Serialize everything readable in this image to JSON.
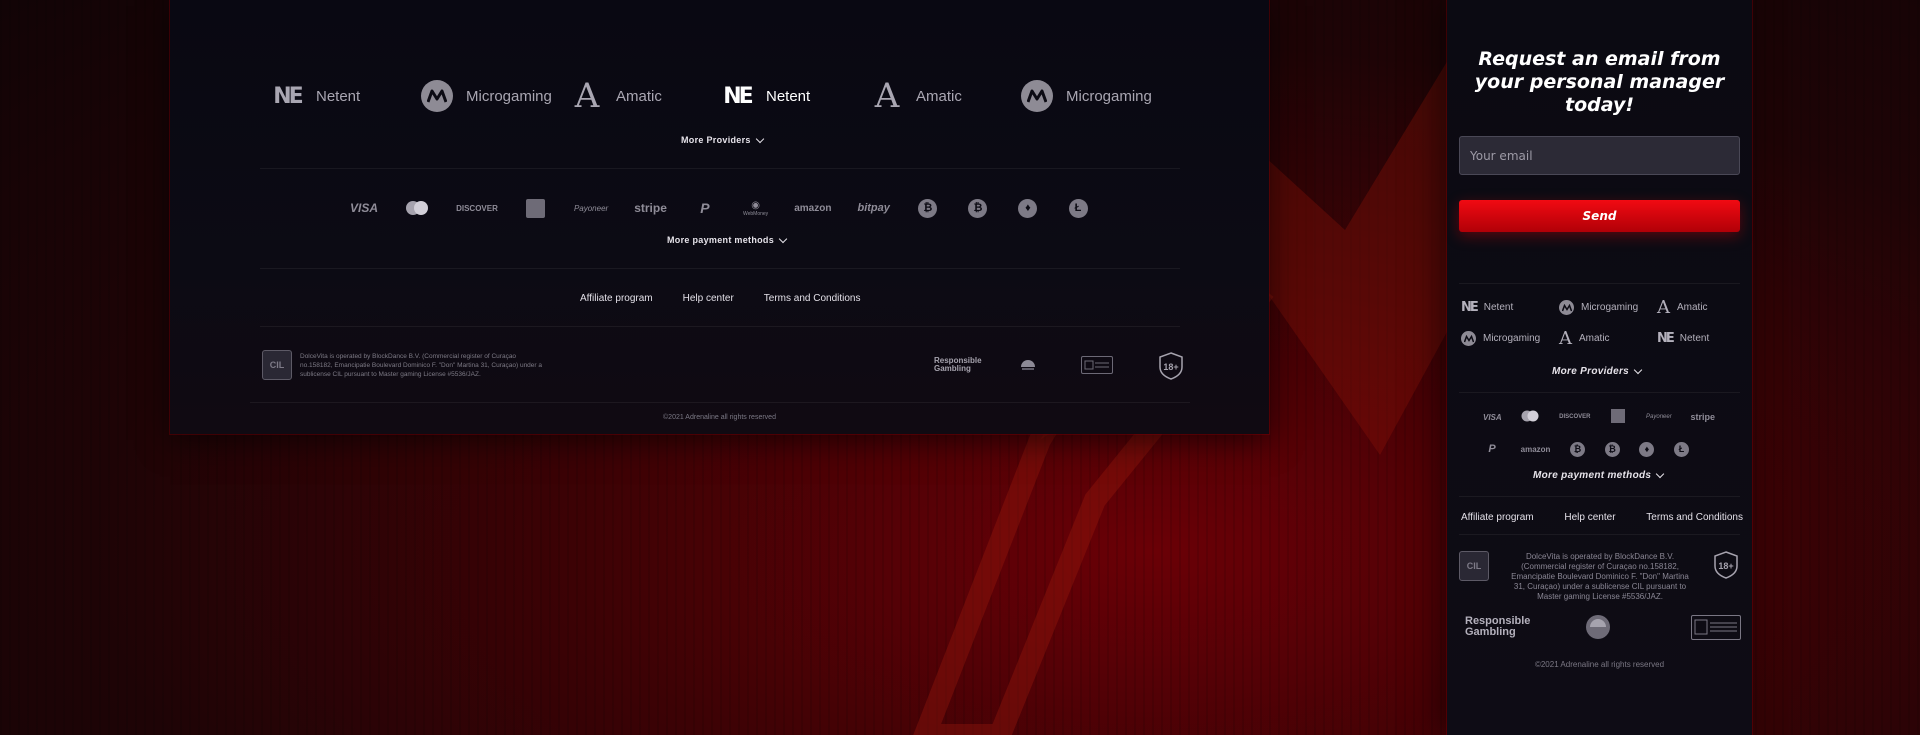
{
  "providers": [
    {
      "name": "Netent",
      "icon": "netent-logo-icon",
      "active": false
    },
    {
      "name": "Microgaming",
      "icon": "microgaming-logo-icon",
      "active": false
    },
    {
      "name": "Amatic",
      "icon": "amatic-logo-icon",
      "active": false
    },
    {
      "name": "Netent",
      "icon": "netent-logo-icon",
      "active": true
    },
    {
      "name": "Amatic",
      "icon": "amatic-logo-icon",
      "active": false
    },
    {
      "name": "Microgaming",
      "icon": "microgaming-logo-icon",
      "active": false
    }
  ],
  "more_providers_label": "More Providers",
  "payment_methods": [
    "VISA",
    "mastercard",
    "DISCOVER",
    "AMEX",
    "Payoneer",
    "stripe",
    "PayPal",
    "WebMoney",
    "amazon",
    "bitpay",
    "Bitcoin",
    "Bitcoin",
    "Ethereum",
    "Litecoin"
  ],
  "payment_labels": {
    "visa": "VISA",
    "discover": "DISCOVER",
    "payoneer": "Payoneer",
    "stripe": "stripe",
    "webmoney": "WebMoney",
    "amazon": "amazon",
    "bitpay": "bitpay"
  },
  "more_payment_label": "More payment methods",
  "footer_links": [
    "Affiliate program",
    "Help center",
    "Terms and Conditions"
  ],
  "license_text": "DolceVita is operated by BlockDance B.V. (Commercial register of Curaçao no.158182, Emancipatie Boulevard Dominico F. \"Don\" Martina 31, Curaçao) under a sublicense CIL pursuant to Master gaming License #5536/JAZ.",
  "license_badge": "CIL",
  "responsible_gambling": "Responsible Gambling",
  "age_badge": "18+",
  "copyright": "©2021 Adrenaline all rights reserved",
  "side": {
    "heading": "Request an email from your personal manager today!",
    "email_placeholder": "Your email",
    "send_label": "Send",
    "providers": [
      {
        "name": "Netent",
        "icon": "netent-logo-icon"
      },
      {
        "name": "Microgaming",
        "icon": "microgaming-logo-icon"
      },
      {
        "name": "Amatic",
        "icon": "amatic-logo-icon"
      },
      {
        "name": "Microgaming",
        "icon": "microgaming-logo-icon"
      },
      {
        "name": "Amatic",
        "icon": "amatic-logo-icon"
      },
      {
        "name": "Netent",
        "icon": "netent-logo-icon"
      }
    ],
    "more_providers_label": "More Providers",
    "more_payment_label": "More payment methods",
    "links": [
      "Affiliate program",
      "Help center",
      "Terms and Conditions"
    ],
    "license_text": "DolceVita is operated by BlockDance B.V. (Commercial register of Curaçao no.158182, Emancipatie Boulevard Dominico F. \"Don\" Martina 31, Curaçao) under a sublicense CIL pursuant to Master gaming License #5536/JAZ.",
    "responsible_gambling": "Responsible Gambling",
    "age_badge": "18+",
    "copyright": "©2021 Adrenaline all rights reserved"
  },
  "colors": {
    "accent_red": "#e10810",
    "panel_bg": "#0b0a12",
    "text_muted": "#7d7a86"
  }
}
